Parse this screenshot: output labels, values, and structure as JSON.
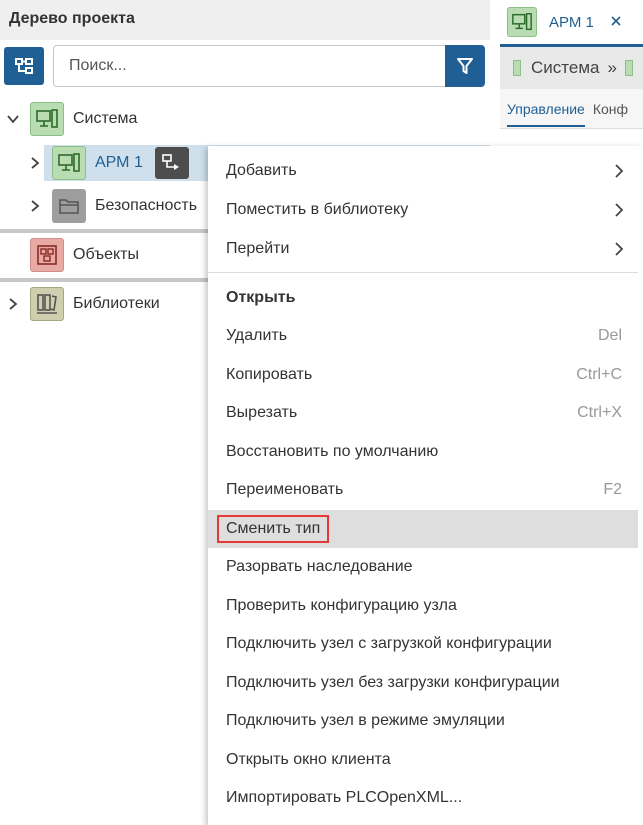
{
  "panel": {
    "title": "Дерево проекта",
    "search_placeholder": "Поиск..."
  },
  "tree": {
    "items": [
      {
        "label": "Система",
        "icon": "node-station-icon",
        "expanded": true
      },
      {
        "label": "АРМ 1",
        "icon": "workstation-icon",
        "selected": true
      },
      {
        "label": "Безопасность",
        "icon": "folder-icon"
      },
      {
        "label": "Объекты",
        "icon": "objects-icon"
      },
      {
        "label": "Библиотеки",
        "icon": "library-icon"
      }
    ]
  },
  "right": {
    "tab_label": "АРМ 1",
    "breadcrumb": "Система",
    "breadcrumb_sep": "»",
    "subtab_active": "Управление",
    "subtab_next": "Конф"
  },
  "menu": {
    "items": [
      {
        "label": "Добавить",
        "submenu": true
      },
      {
        "label": "Поместить в библиотеку",
        "submenu": true
      },
      {
        "label": "Перейти",
        "submenu": true
      },
      {
        "label": "Открыть",
        "bold": true
      },
      {
        "label": "Удалить",
        "shortcut": "Del"
      },
      {
        "label": "Копировать",
        "shortcut": "Ctrl+C"
      },
      {
        "label": "Вырезать",
        "shortcut": "Ctrl+X"
      },
      {
        "label": "Восстановить по умолчанию"
      },
      {
        "label": "Переименовать",
        "shortcut": "F2"
      },
      {
        "label": "Сменить тип",
        "highlighted": true
      },
      {
        "label": "Разорвать наследование"
      },
      {
        "label": "Проверить конфигурацию узла"
      },
      {
        "label": "Подключить узел с загрузкой конфигурации"
      },
      {
        "label": "Подключить узел без загрузки конфигурации"
      },
      {
        "label": "Подключить узел в режиме эмуляции"
      },
      {
        "label": "Открыть окно клиента"
      },
      {
        "label": "Импортировать PLCOpenXML..."
      }
    ]
  },
  "colors": {
    "accent": "#1f5f93",
    "highlight_border": "#e53935",
    "selected_row": "#cfe0ec"
  }
}
